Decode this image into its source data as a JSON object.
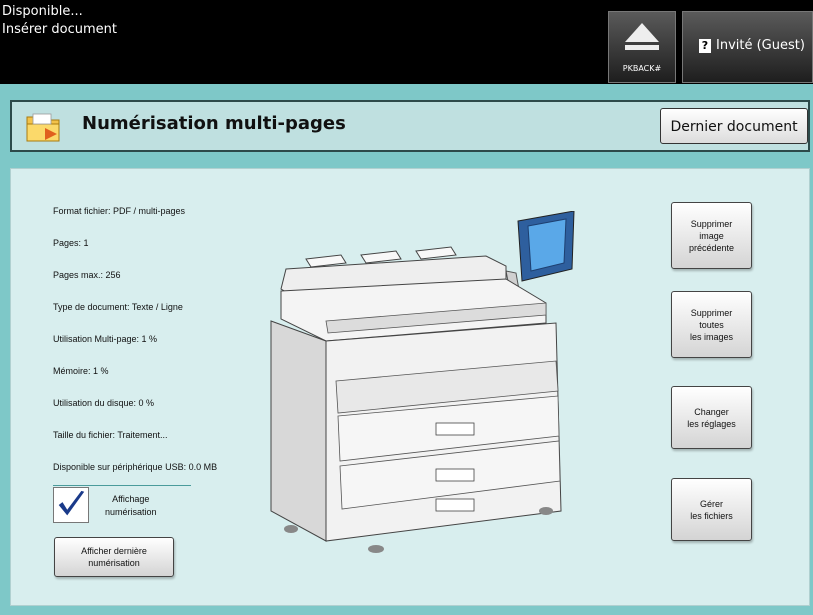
{
  "status": {
    "line1": "Disponible...",
    "line2": "Insérer document"
  },
  "header_buttons": {
    "eject_label": "PKBACK#",
    "guest_label": "Invité (Guest)"
  },
  "title": {
    "text": "Numérisation multi-pages",
    "last_doc_label": "Dernier document"
  },
  "info": {
    "format": "Format fichier:  PDF / multi-pages",
    "pages": "Pages:  1",
    "pages_max": "Pages max.:  256",
    "doc_type": "Type de document:  Texte / Ligne",
    "multipage": "Utilisation Multi-page:  1 %",
    "memory": "Mémoire:  1 %",
    "disk": "Utilisation du disque:  0 %",
    "file_size": "Taille du fichier:  Traitement...",
    "usb": "Disponible sur périphérique USB:  0.0 MB"
  },
  "preview": {
    "checkbox_line1": "Affichage",
    "checkbox_line2": "numérisation",
    "checked": true
  },
  "show_last": {
    "line1": "Afficher dernière",
    "line2": "numérisation"
  },
  "actions": {
    "delete_prev": [
      "Supprimer",
      "image",
      "précédente"
    ],
    "delete_all": [
      "Supprimer",
      "toutes",
      "les images"
    ],
    "change": [
      "Changer",
      "les réglages"
    ],
    "manage": [
      "Gérer",
      "les fichiers"
    ]
  },
  "icons": {
    "eject": "eject-icon",
    "help": "help-icon",
    "folder": "folder-scan-icon",
    "check": "checkmark-icon"
  }
}
